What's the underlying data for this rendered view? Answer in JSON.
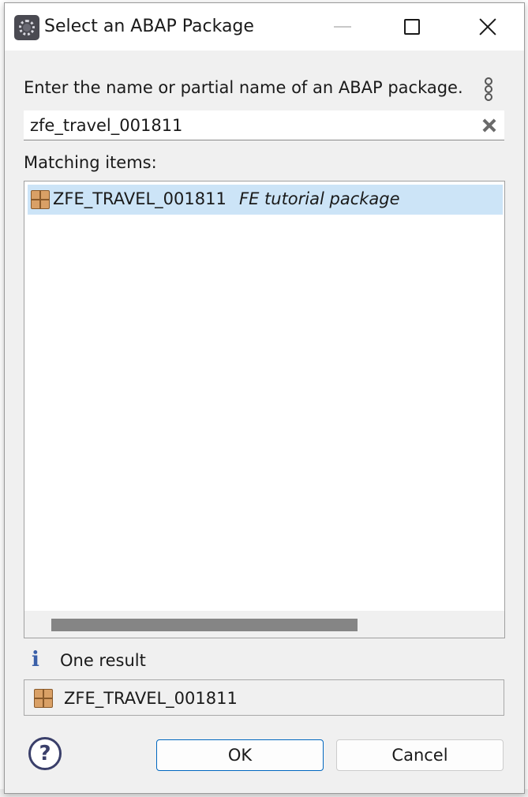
{
  "window": {
    "title": "Select an ABAP Package"
  },
  "dialog": {
    "prompt": "Enter the name or partial name of an ABAP package.",
    "search_value": "zfe_travel_001811",
    "matching_label": "Matching items:",
    "results": [
      {
        "name": "ZFE_TRAVEL_001811",
        "description": "FE tutorial package",
        "icon": "package-icon",
        "selected": true
      }
    ],
    "horizontal_scroll_fraction": 0.64,
    "status": "One result",
    "selected_item": "ZFE_TRAVEL_001811"
  },
  "buttons": {
    "ok": "OK",
    "cancel": "Cancel"
  },
  "colors": {
    "selection": "#cce4f7",
    "default_button_border": "#0067c0",
    "info_icon": "#3a5fa8"
  }
}
